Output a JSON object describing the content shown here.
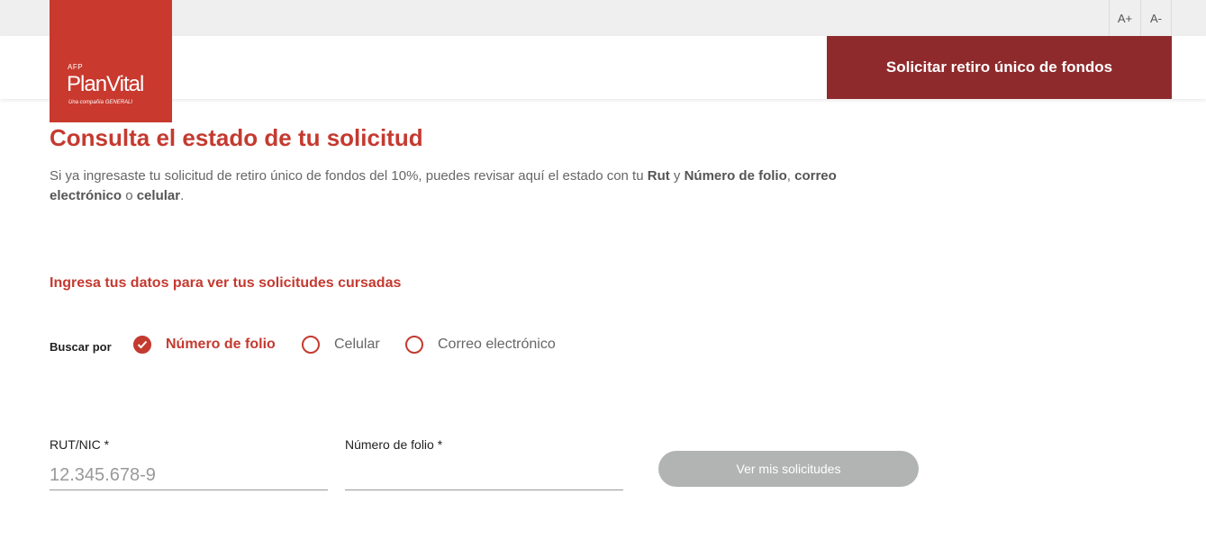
{
  "header": {
    "font_increase": "A+",
    "font_decrease": "A-",
    "logo": {
      "prefix": "AFP",
      "brand": "PlanVital",
      "tagline": "Una compañía GENERALI"
    },
    "cta_label": "Solicitar retiro único de fondos"
  },
  "main": {
    "title": "Consulta el estado de tu solicitud",
    "description": {
      "part1": "Si ya ingresaste tu solicitud de retiro único de fondos del 10%, puedes revisar aquí el estado con tu ",
      "rut": "Rut",
      "part2": " y ",
      "folio": "Número de folio",
      "part3": ", ",
      "correo": "correo electrónico",
      "part4": " o ",
      "celular": "celular",
      "part5": "."
    },
    "subtitle": "Ingresa tus datos para ver tus solicitudes cursadas",
    "search_by": {
      "label": "Buscar por",
      "options": [
        {
          "label": "Número de folio",
          "selected": true
        },
        {
          "label": "Celular",
          "selected": false
        },
        {
          "label": "Correo electrónico",
          "selected": false
        }
      ]
    },
    "form": {
      "rut_label": "RUT/NIC *",
      "rut_value": "",
      "rut_placeholder": "12.345.678-9",
      "folio_label": "Número de folio *",
      "folio_value": "",
      "folio_placeholder": "",
      "submit_label": "Ver mis solicitudes"
    }
  },
  "colors": {
    "brand_red": "#c43a30",
    "cta_dark_red": "#8e2a2c",
    "button_disabled": "#b2b3b3"
  }
}
